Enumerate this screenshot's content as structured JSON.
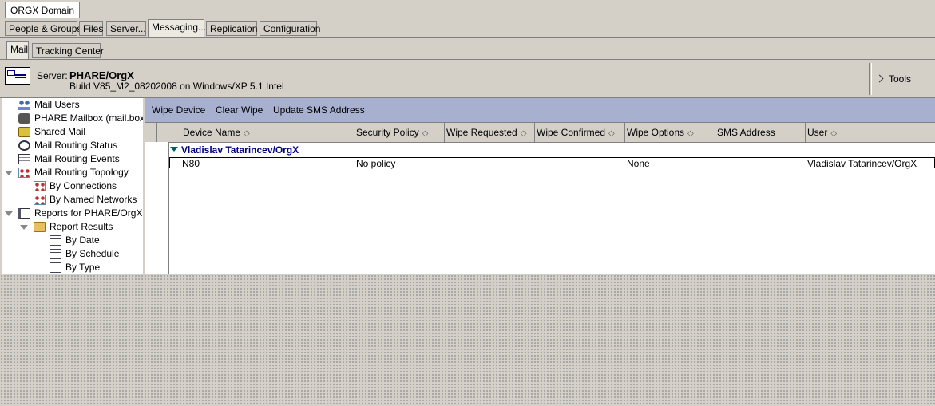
{
  "window_tab": "ORGX Domain",
  "nav_tabs": [
    "People & Groups",
    "Files",
    "Server...",
    "Messaging...",
    "Replication",
    "Configuration"
  ],
  "sub_tabs": [
    "Mail",
    "Tracking Center"
  ],
  "server": {
    "label": "Server:",
    "name": "PHARE/OrgX",
    "build": "Build V85_M2_08202008 on Windows/XP 5.1 Intel",
    "tools": "Tools"
  },
  "tree": [
    {
      "label": "Mail Users",
      "icon": "users-icon"
    },
    {
      "label": "PHARE Mailbox (mail.box)",
      "icon": "mailbox-icon"
    },
    {
      "label": "Shared Mail",
      "icon": "shared-mail-icon"
    },
    {
      "label": "Mail Routing Status",
      "icon": "gauge-icon"
    },
    {
      "label": "Mail Routing Events",
      "icon": "events-icon"
    },
    {
      "label": "Mail Routing Topology",
      "icon": "topology-icon"
    },
    {
      "label": "By Connections",
      "icon": "topology-icon"
    },
    {
      "label": "By Named Networks",
      "icon": "topology-icon"
    },
    {
      "label": "Reports for PHARE/OrgX",
      "icon": "book-icon"
    },
    {
      "label": "Report Results",
      "icon": "folder-icon"
    },
    {
      "label": "By Date",
      "icon": "view-icon"
    },
    {
      "label": "By Schedule",
      "icon": "view-icon"
    },
    {
      "label": "By Type",
      "icon": "view-icon"
    }
  ],
  "actions": [
    "Wipe Device",
    "Clear Wipe",
    "Update SMS Address"
  ],
  "columns": [
    "Device Name",
    "Security Policy",
    "Wipe Requested",
    "Wipe Confirmed",
    "Wipe Options",
    "SMS Address",
    "User"
  ],
  "group": "Vladislav Tatarincev/OrgX",
  "rows": [
    {
      "device": "N80",
      "policy": "No policy",
      "wipe_requested": "",
      "wipe_confirmed": "",
      "options": "None",
      "sms": "",
      "user": "Vladislav Tatarincev/OrgX"
    }
  ]
}
